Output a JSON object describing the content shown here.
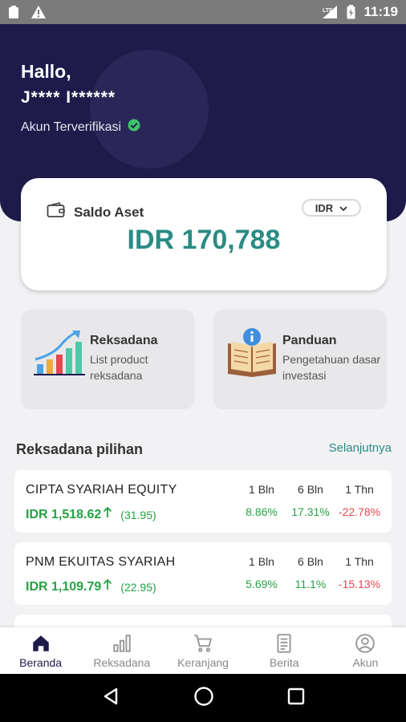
{
  "status_bar": {
    "time": "11:19",
    "network": "LTE"
  },
  "header": {
    "greeting": "Hallo,",
    "username": "J**** I******",
    "verified_label": "Akun Terverifikasi"
  },
  "balance": {
    "label": "Saldo Aset",
    "currency": "IDR",
    "amount": "IDR 170,788"
  },
  "quick_menu": [
    {
      "title": "Reksadana",
      "subtitle": "List product reksadana",
      "icon": "growth-chart-icon"
    },
    {
      "title": "Panduan",
      "subtitle": "Pengetahuan dasar investasi",
      "icon": "guide-book-icon"
    }
  ],
  "featured": {
    "title": "Reksadana pilihan",
    "more_label": "Selanjutnya",
    "period_headers": [
      "1 Bln",
      "6 Bln",
      "1 Thn"
    ],
    "funds": [
      {
        "name": "CIPTA SYARIAH EQUITY",
        "price": "IDR 1,518.62",
        "change": "(31.95)",
        "returns": [
          "8.86%",
          "17.31%",
          "-22.78%"
        ]
      },
      {
        "name": "PNM EKUITAS SYARIAH",
        "price": "IDR 1,109.79",
        "change": "(22.95)",
        "returns": [
          "5.69%",
          "11.1%",
          "-15.13%"
        ]
      }
    ]
  },
  "bottom_nav": [
    {
      "label": "Beranda",
      "icon": "home-icon",
      "active": true
    },
    {
      "label": "Reksadana",
      "icon": "bar-chart-icon",
      "active": false
    },
    {
      "label": "Keranjang",
      "icon": "cart-icon",
      "active": false
    },
    {
      "label": "Berita",
      "icon": "news-icon",
      "active": false
    },
    {
      "label": "Akun",
      "icon": "account-icon",
      "active": false
    }
  ],
  "colors": {
    "header_bg": "#1e1b4b",
    "accent": "#2a8c84",
    "positive": "#25a244",
    "negative": "#e5484d"
  }
}
